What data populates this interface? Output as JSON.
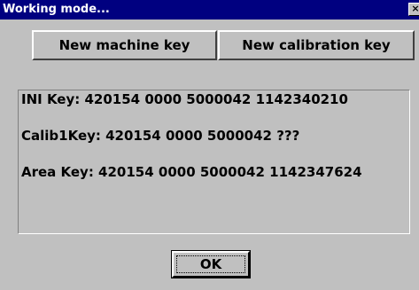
{
  "window": {
    "title": "Working mode...",
    "close_label": "×"
  },
  "buttons": {
    "new_machine_key": "New machine key",
    "new_calibration_key": "New calibration key",
    "ok": "OK"
  },
  "keys": {
    "ini": "INI Key: 420154 0000 5000042 1142340210",
    "calib1": "Calib1Key: 420154 0000 5000042 ???",
    "area": "Area Key: 420154 0000 5000042 1142347624"
  }
}
